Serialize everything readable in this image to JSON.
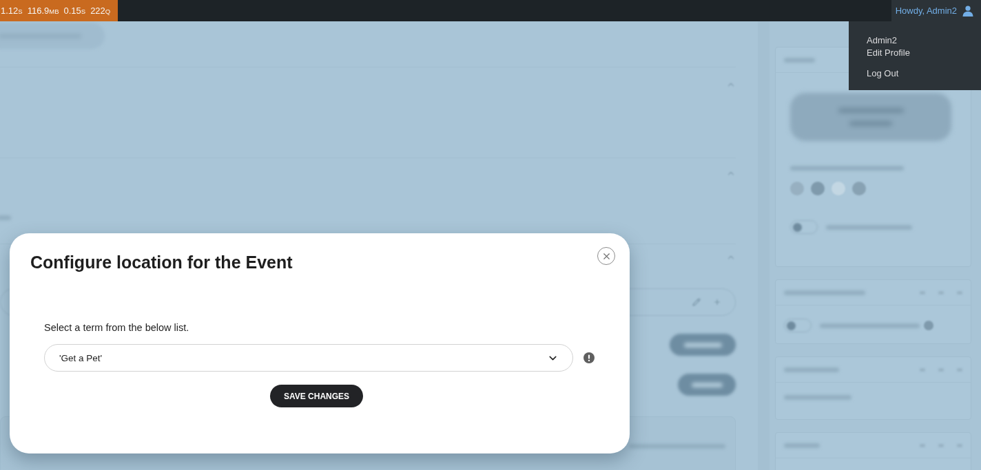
{
  "admin_bar": {
    "perf_stats": [
      {
        "value": "1.12",
        "unit": "S"
      },
      {
        "value": "116.9",
        "unit": "MB"
      },
      {
        "value": "0.15",
        "unit": "S"
      },
      {
        "value": "222",
        "unit": "Q"
      }
    ],
    "account": {
      "greeting": "Howdy, Admin2",
      "expanded": true,
      "menu_groups": [
        {
          "items": [
            "Admin2",
            "Edit Profile"
          ]
        },
        {
          "items": [
            "Log Out"
          ]
        }
      ]
    }
  },
  "backdrop": {
    "toggles": [
      {
        "on": false
      },
      {
        "on": false
      }
    ]
  },
  "modal": {
    "title": "Configure location for the Event",
    "prompt": "Select a term from the below list.",
    "term_select": {
      "value": "'Get a Pet'"
    },
    "save_button": "SAVE CHANGES"
  }
}
